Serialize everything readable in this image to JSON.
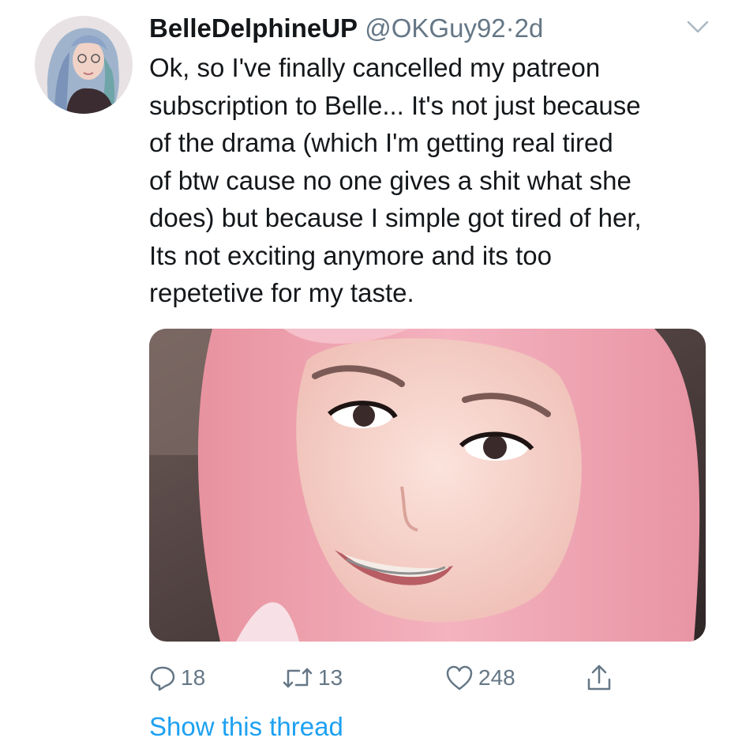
{
  "tweet": {
    "display_name": "BelleDelphineUP",
    "handle": "@OKGuy92",
    "separator": "·",
    "time": "2d",
    "lines": [
      "Ok, so I've finally cancelled my patreon",
      "subscription to Belle... It's not just because",
      "of the drama (which I'm getting real tired",
      "of btw cause no one gives a shit what she",
      "does) but because I simple got tired of her,",
      "Its not exciting anymore and its too",
      "repetetive for my taste."
    ],
    "media": {
      "description": "selfie photo of a person with pink hair"
    },
    "actions": {
      "reply_icon": "reply-icon",
      "reply_count": "18",
      "retweet_icon": "retweet-icon",
      "retweet_count": "13",
      "like_icon": "like-icon",
      "like_count": "248",
      "share_icon": "share-icon"
    },
    "show_thread": "Show this thread"
  },
  "colors": {
    "text": "#14171a",
    "secondary": "#657786",
    "link": "#1da1f2",
    "hair": "#f2a7b7"
  }
}
